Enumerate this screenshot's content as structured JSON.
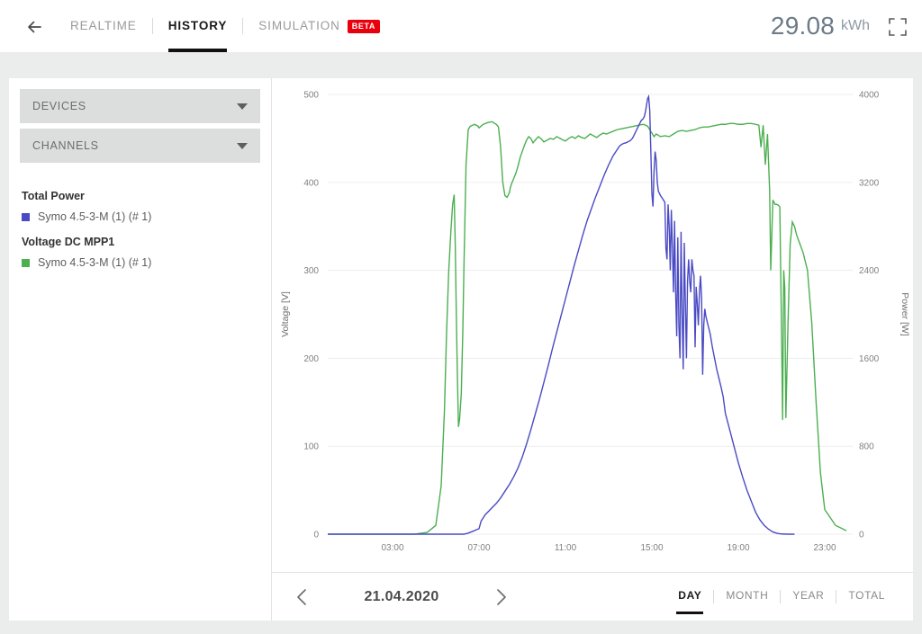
{
  "header": {
    "back_icon": "arrow-left-icon",
    "tabs": [
      {
        "label": "REALTIME",
        "active": false,
        "badge": null
      },
      {
        "label": "HISTORY",
        "active": true,
        "badge": null
      },
      {
        "label": "SIMULATION",
        "active": false,
        "badge": "BETA"
      }
    ],
    "energy_value": "29.08",
    "energy_unit": "kWh",
    "fullscreen_icon": "fullscreen-expand-icon",
    "badge_color": "#e8000d"
  },
  "sidebar": {
    "accordions": [
      {
        "label": "DEVICES",
        "icon": "chevron-down-icon"
      },
      {
        "label": "CHANNELS",
        "icon": "chevron-down-icon"
      }
    ],
    "legend_groups": [
      {
        "title": "Total Power",
        "items": [
          {
            "label": "Symo 4.5-3-M (1) (# 1)",
            "color": "#4a4ac4"
          }
        ]
      },
      {
        "title": "Voltage DC MPP1",
        "items": [
          {
            "label": "Symo 4.5-3-M (1) (# 1)",
            "color": "#4caf50"
          }
        ]
      }
    ]
  },
  "footer": {
    "prev_icon": "chevron-left-icon",
    "next_icon": "chevron-right-icon",
    "date": "21.04.2020",
    "range_tabs": [
      {
        "label": "DAY",
        "active": true
      },
      {
        "label": "MONTH",
        "active": false
      },
      {
        "label": "YEAR",
        "active": false
      },
      {
        "label": "TOTAL",
        "active": false
      }
    ]
  },
  "chart_data": {
    "type": "line",
    "title": "",
    "xlabel": "",
    "ylabel": "Voltage [V]",
    "y2label": "Power [W]",
    "grid": true,
    "legend_position": "sidebar-left",
    "x_type": "time-of-day",
    "xlim": [
      0,
      24
    ],
    "x_ticks": [
      3,
      7,
      11,
      15,
      19,
      23
    ],
    "x_tick_labels": [
      "03:00",
      "07:00",
      "11:00",
      "15:00",
      "19:00",
      "23:00"
    ],
    "ylim": [
      0,
      500
    ],
    "y_ticks": [
      0,
      100,
      200,
      300,
      400,
      500
    ],
    "y_tick_labels": [
      "0",
      "100",
      "200",
      "300",
      "400",
      "500"
    ],
    "y2lim": [
      0,
      4000
    ],
    "y2_ticks": [
      0,
      800,
      1600,
      2400,
      3200,
      4000
    ],
    "y2_tick_labels": [
      "0",
      "800",
      "1600",
      "2400",
      "3200",
      "4000"
    ],
    "series": [
      {
        "name": "Voltage DC MPP1 — Symo 4.5-3-M (1) (# 1)",
        "color": "#4caf50",
        "axis": "left",
        "unit": "V",
        "x": [
          0.0,
          1.0,
          2.0,
          3.0,
          4.0,
          4.6,
          5.0,
          5.25,
          5.4,
          5.5,
          5.6,
          5.7,
          5.78,
          5.85,
          5.9,
          5.95,
          6.0,
          6.05,
          6.1,
          6.18,
          6.25,
          6.3,
          6.35,
          6.4,
          6.5,
          6.6,
          6.62,
          6.7,
          6.8,
          6.95,
          7.0,
          7.1,
          7.2,
          7.4,
          7.6,
          7.8,
          7.9,
          8.0,
          8.1,
          8.2,
          8.3,
          8.4,
          8.45,
          8.5,
          8.6,
          8.7,
          8.8,
          8.9,
          9.0,
          9.1,
          9.2,
          9.3,
          9.4,
          9.5,
          9.6,
          9.75,
          9.9,
          10.0,
          10.15,
          10.3,
          10.45,
          10.6,
          10.75,
          10.9,
          11.0,
          11.15,
          11.3,
          11.45,
          11.6,
          11.75,
          11.9,
          12.0,
          12.15,
          12.3,
          12.45,
          12.6,
          12.75,
          12.9,
          13.0,
          13.2,
          13.4,
          13.6,
          13.8,
          14.0,
          14.2,
          14.4,
          14.6,
          14.8,
          14.9,
          15.0,
          15.1,
          15.2,
          15.4,
          15.6,
          15.8,
          16.0,
          16.2,
          16.4,
          16.6,
          16.8,
          17.0,
          17.2,
          17.4,
          17.6,
          17.8,
          18.0,
          18.2,
          18.4,
          18.6,
          18.8,
          19.0,
          19.2,
          19.4,
          19.6,
          19.8,
          19.95,
          20.05,
          20.15,
          20.25,
          20.35,
          20.45,
          20.5,
          20.6,
          20.7,
          20.78,
          20.85,
          20.92,
          21.0,
          21.05,
          21.1,
          21.15,
          21.2,
          21.3,
          21.4,
          21.5,
          21.6,
          21.7,
          21.85,
          22.0,
          22.2,
          22.4,
          22.6,
          22.8,
          23.0,
          23.5,
          24.0
        ],
        "y": [
          0,
          0,
          0,
          0,
          0,
          2,
          10,
          55,
          140,
          230,
          300,
          345,
          375,
          386,
          330,
          250,
          180,
          122,
          130,
          160,
          230,
          300,
          360,
          420,
          460,
          464,
          464,
          465,
          466,
          464,
          462,
          464,
          466,
          468,
          469,
          466,
          463,
          440,
          400,
          385,
          383,
          388,
          394,
          398,
          404,
          410,
          418,
          428,
          435,
          442,
          448,
          452,
          450,
          445,
          448,
          452,
          449,
          446,
          448,
          450,
          449,
          452,
          450,
          448,
          447,
          450,
          452,
          450,
          453,
          451,
          450,
          452,
          455,
          453,
          451,
          454,
          456,
          455,
          456,
          458,
          460,
          461,
          462,
          463,
          464,
          465,
          466,
          464,
          460,
          456,
          452,
          455,
          452,
          453,
          452,
          455,
          458,
          459,
          458,
          459,
          460,
          462,
          463,
          463,
          464,
          465,
          466,
          466,
          467,
          467,
          466,
          466,
          467,
          467,
          466,
          465,
          440,
          465,
          420,
          455,
          390,
          300,
          380,
          375,
          375,
          374,
          372,
          230,
          130,
          300,
          280,
          132,
          240,
          330,
          355,
          350,
          340,
          330,
          320,
          300,
          240,
          150,
          70,
          28,
          10,
          4,
          2,
          1,
          0
        ]
      },
      {
        "name": "Total Power — Symo 4.5-3-M (1) (# 1)",
        "color": "#4a4ac4",
        "axis": "right",
        "unit": "W",
        "x": [
          0.0,
          2.0,
          4.0,
          5.0,
          5.5,
          6.0,
          6.3,
          6.5,
          6.7,
          6.85,
          7.0,
          7.1,
          7.2,
          7.3,
          7.45,
          7.6,
          7.8,
          8.0,
          8.2,
          8.4,
          8.6,
          8.8,
          9.0,
          9.2,
          9.4,
          9.6,
          9.8,
          10.0,
          10.2,
          10.4,
          10.6,
          10.8,
          11.0,
          11.2,
          11.4,
          11.6,
          11.8,
          12.0,
          12.2,
          12.4,
          12.6,
          12.8,
          13.0,
          13.2,
          13.4,
          13.5,
          13.6,
          13.7,
          13.8,
          13.9,
          14.0,
          14.1,
          14.2,
          14.3,
          14.4,
          14.5,
          14.6,
          14.65,
          14.7,
          14.75,
          14.8,
          14.85,
          14.9,
          14.95,
          15.0,
          15.05,
          15.1,
          15.15,
          15.2,
          15.25,
          15.3,
          15.4,
          15.5,
          15.6,
          15.65,
          15.7,
          15.75,
          15.8,
          15.85,
          15.9,
          15.95,
          16.0,
          16.05,
          16.1,
          16.15,
          16.2,
          16.25,
          16.3,
          16.35,
          16.4,
          16.45,
          16.5,
          16.55,
          16.6,
          16.65,
          16.7,
          16.75,
          16.8,
          16.85,
          16.9,
          16.95,
          17.0,
          17.05,
          17.1,
          17.15,
          17.2,
          17.25,
          17.3,
          17.35,
          17.4,
          17.45,
          17.5,
          17.6,
          17.7,
          17.8,
          17.9,
          18.0,
          18.1,
          18.2,
          18.3,
          18.4,
          18.6,
          18.8,
          19.0,
          19.2,
          19.4,
          19.6,
          19.8,
          20.0,
          20.2,
          20.4,
          20.6,
          20.8,
          21.0,
          21.3,
          21.6,
          22.0,
          23.0,
          24.0
        ],
        "y": [
          0,
          0,
          0,
          0,
          0,
          0,
          0,
          10,
          25,
          38,
          50,
          120,
          150,
          180,
          210,
          240,
          280,
          330,
          390,
          450,
          520,
          600,
          700,
          820,
          950,
          1090,
          1230,
          1380,
          1530,
          1690,
          1840,
          1990,
          2140,
          2290,
          2440,
          2580,
          2720,
          2850,
          2960,
          3070,
          3170,
          3270,
          3360,
          3440,
          3500,
          3530,
          3545,
          3555,
          3560,
          3570,
          3580,
          3600,
          3640,
          3680,
          3720,
          3760,
          3780,
          3800,
          3840,
          3900,
          3960,
          3980,
          3860,
          3500,
          3100,
          2980,
          3300,
          3480,
          3400,
          3200,
          3120,
          3080,
          3050,
          3020,
          2600,
          2500,
          3000,
          2800,
          2400,
          2950,
          2600,
          2200,
          2850,
          2200,
          1800,
          2700,
          1900,
          1600,
          2750,
          2000,
          1500,
          2650,
          2100,
          1600,
          2300,
          2500,
          2300,
          2200,
          2500,
          2400,
          2350,
          1700,
          2250,
          2100,
          1900,
          2200,
          2350,
          2150,
          1450,
          1900,
          2050,
          1980,
          1900,
          1820,
          1700,
          1600,
          1500,
          1420,
          1340,
          1250,
          1100,
          950,
          800,
          650,
          520,
          400,
          300,
          200,
          130,
          80,
          45,
          20,
          8,
          2,
          0,
          0
        ]
      }
    ]
  }
}
